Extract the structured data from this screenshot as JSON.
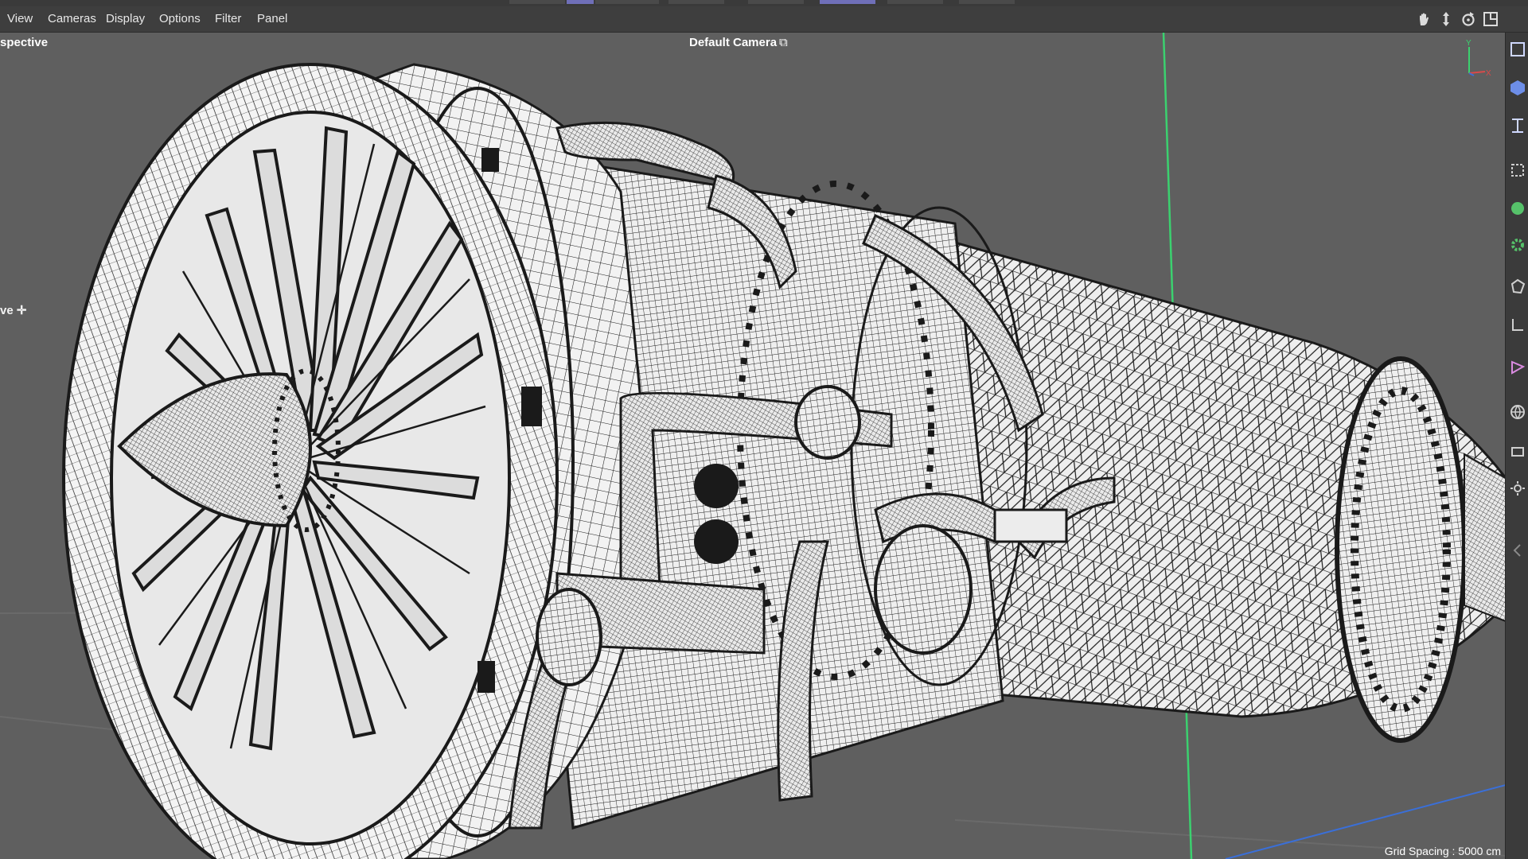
{
  "menubar": {
    "items": [
      "View",
      "Cameras",
      "Display",
      "Options",
      "Filter",
      "Panel"
    ]
  },
  "viewport": {
    "projection_label": "spective",
    "camera_label": "Default Camera",
    "camera_icon": "camera-link-icon",
    "move_label": "ve",
    "grid_spacing_label": "Grid Spacing : 5000 cm",
    "axis_labels": {
      "y": "Y",
      "x": "X"
    },
    "render_mode": "wireframe"
  },
  "navigation_icons": [
    "pan-hand-icon",
    "move-arrows-icon",
    "rotate-icon",
    "maximize-view-icon"
  ],
  "right_toolbar_icons": [
    "cube-outline-icon",
    "cube-solid-icon",
    "bend-icon",
    "select-icon",
    "spline-green-icon",
    "gear-green-icon",
    "polygon-icon",
    "point-icon",
    "edge-icon",
    "globe-icon",
    "layer-icon",
    "light-icon",
    "collapse-icon"
  ],
  "colors": {
    "viewport_bg": "#5f5f5f",
    "menubar_bg": "#3e3e3e",
    "wire": "#1a1a1a",
    "surface": "#f2f2f2",
    "y_axis": "#3bd16f",
    "x_axis": "#d94a4a",
    "horizon_line": "#3a6fd8"
  }
}
